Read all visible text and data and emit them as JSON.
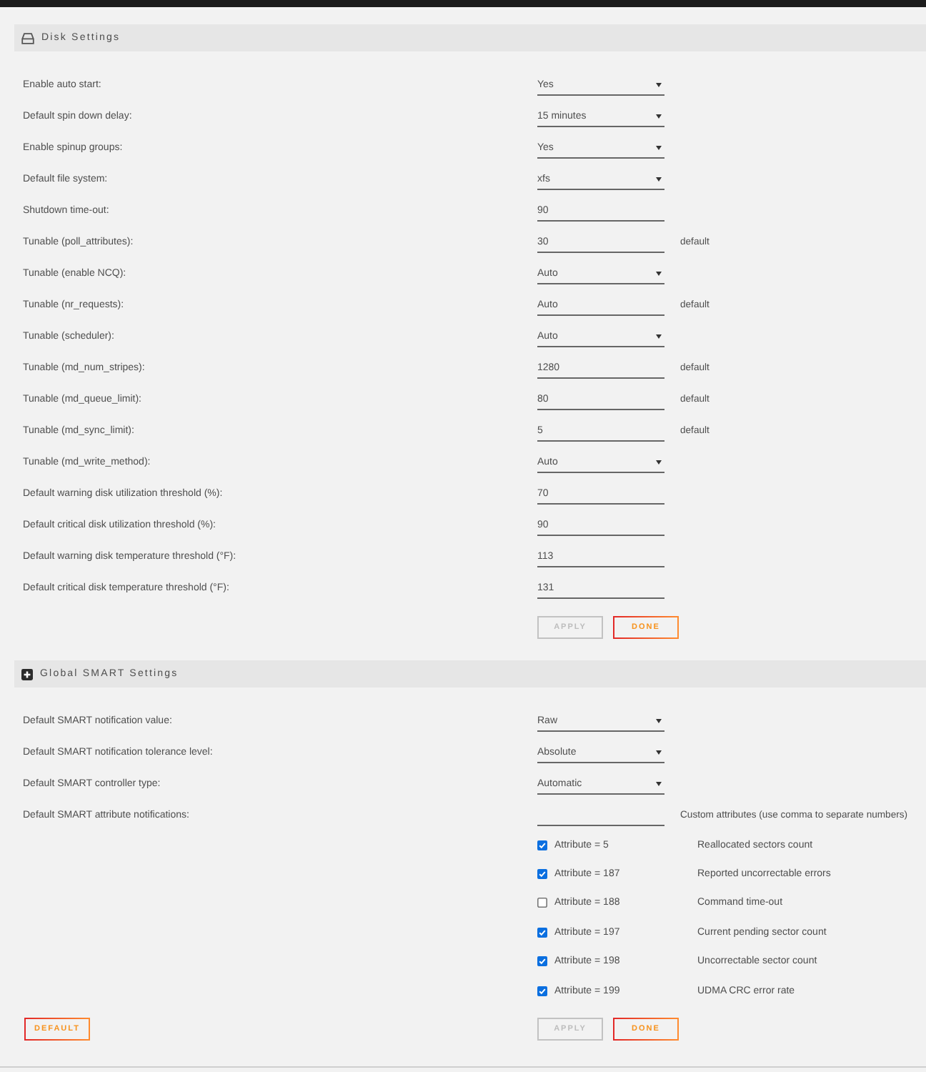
{
  "disk_settings": {
    "title": "Disk Settings",
    "rows": [
      {
        "label": "Enable auto start:",
        "kind": "select",
        "value": "Yes"
      },
      {
        "label": "Default spin down delay:",
        "kind": "select",
        "value": "15 minutes"
      },
      {
        "label": "Enable spinup groups:",
        "kind": "select",
        "value": "Yes"
      },
      {
        "label": "Default file system:",
        "kind": "select",
        "value": "xfs"
      },
      {
        "label": "Shutdown time-out:",
        "kind": "input",
        "value": "90"
      },
      {
        "label": "Tunable (poll_attributes):",
        "kind": "input",
        "value": "30",
        "note": "default"
      },
      {
        "label": "Tunable (enable NCQ):",
        "kind": "select",
        "value": "Auto"
      },
      {
        "label": "Tunable (nr_requests):",
        "kind": "input",
        "value": "Auto",
        "note": "default"
      },
      {
        "label": "Tunable (scheduler):",
        "kind": "select",
        "value": "Auto"
      },
      {
        "label": "Tunable (md_num_stripes):",
        "kind": "input",
        "value": "1280",
        "note": "default"
      },
      {
        "label": "Tunable (md_queue_limit):",
        "kind": "input",
        "value": "80",
        "note": "default"
      },
      {
        "label": "Tunable (md_sync_limit):",
        "kind": "input",
        "value": "5",
        "note": "default"
      },
      {
        "label": "Tunable (md_write_method):",
        "kind": "select",
        "value": "Auto"
      },
      {
        "label": "Default warning disk utilization threshold (%):",
        "kind": "input",
        "value": "70"
      },
      {
        "label": "Default critical disk utilization threshold (%):",
        "kind": "input",
        "value": "90"
      },
      {
        "label": "Default warning disk temperature threshold (°F):",
        "kind": "input",
        "value": "113"
      },
      {
        "label": "Default critical disk temperature threshold (°F):",
        "kind": "input",
        "value": "131"
      }
    ],
    "buttons": [
      {
        "label": "APPLY",
        "disabled": true
      },
      {
        "label": "DONE",
        "disabled": false
      }
    ]
  },
  "global_smart_settings": {
    "title": "Global SMART Settings",
    "rows": [
      {
        "label": "Default SMART notification value:",
        "kind": "select",
        "value": "Raw"
      },
      {
        "label": "Default SMART notification tolerance level:",
        "kind": "select",
        "value": "Absolute"
      },
      {
        "label": "Default SMART controller type:",
        "kind": "select",
        "value": "Automatic"
      },
      {
        "label": "Default SMART attribute notifications:",
        "kind": "input",
        "note": "Custom attributes (use comma to separate numbers)"
      }
    ],
    "attributes": [
      {
        "label": "Attribute = 5",
        "description": "Reallocated sectors count",
        "checked": true
      },
      {
        "label": "Attribute = 187",
        "description": "Reported uncorrectable errors",
        "checked": true
      },
      {
        "label": "Attribute = 188",
        "description": "Command time-out",
        "checked": false
      },
      {
        "label": "Attribute = 197",
        "description": "Current pending sector count",
        "checked": true
      },
      {
        "label": "Attribute = 198",
        "description": "Uncorrectable sector count",
        "checked": true
      },
      {
        "label": "Attribute = 199",
        "description": "UDMA CRC error rate",
        "checked": true
      }
    ],
    "default_button": "DEFAULT",
    "buttons": [
      {
        "label": "APPLY",
        "disabled": true
      },
      {
        "label": "DONE",
        "disabled": false
      }
    ]
  }
}
